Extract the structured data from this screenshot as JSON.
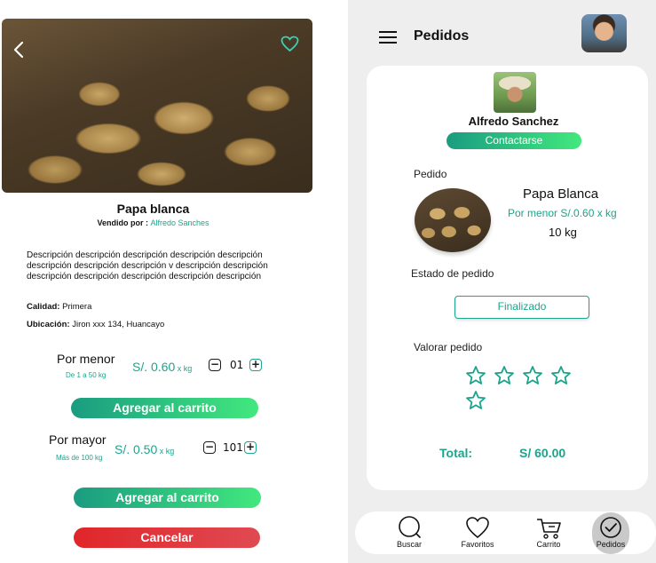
{
  "product": {
    "name": "Papa blanca",
    "sold_by_label": "Vendido por : ",
    "seller": "Alfredo Sanches",
    "description": "Descripción descripción descripción descripción descripción descripción descripción descripción v descripción descripción descripción descripción descripción descripción descripción",
    "quality_label": "Calidad:",
    "quality_value": " Primera",
    "location_label": "Ubicación:",
    "location_value": " Jiron xxx 134, Huancayo"
  },
  "pricing": {
    "retail": {
      "label": "Por menor",
      "range": "De 1 a 50 kg",
      "price": "S/. 0.60",
      "unit": " x kg",
      "qty": "01"
    },
    "wholesale": {
      "label": "Por mayor",
      "range": "Más de  100 kg",
      "price": "S/. 0.50",
      "unit": " x kg",
      "qty": "101"
    }
  },
  "buttons": {
    "add_to_cart_1": "Agregar al carrito",
    "add_to_cart_2": "Agregar al carrito",
    "cancel": "Cancelar",
    "minus": "−",
    "plus": "+"
  },
  "orders": {
    "title": "Pedidos",
    "seller_name": "Alfredo Sanchez",
    "contact": "Contactarse",
    "order_label": "Pedido",
    "product_name": "Papa Blanca",
    "product_price": "Por menor  S/.0.60 x kg",
    "product_qty": "10 kg",
    "status_label": "Estado  de pedido",
    "status_value": "Finalizado",
    "rate_label": "Valorar pedido",
    "total_label": "Total:",
    "total_value": "S/ 60.00"
  },
  "nav": {
    "items": [
      {
        "label": "Buscar",
        "icon": "search-icon"
      },
      {
        "label": "Favoritos",
        "icon": "heart-icon"
      },
      {
        "label": "Carrito",
        "icon": "cart-icon"
      },
      {
        "label": "Pedidos",
        "icon": "check-circle-icon"
      }
    ]
  },
  "colors": {
    "accent": "#1aa58c",
    "green_light": "#42e87e",
    "red": "#e0262a"
  }
}
